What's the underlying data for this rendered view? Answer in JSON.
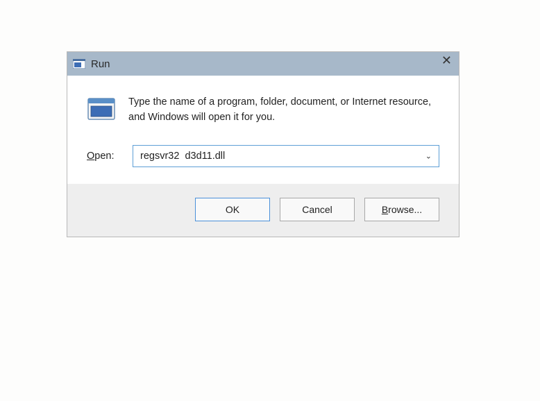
{
  "dialog": {
    "title": "Run",
    "description": "Type the name of a program, folder, document, or Internet resource, and Windows will open it for you.",
    "open_label_prefix": "O",
    "open_label_rest": "pen:",
    "command_value": "regsvr32  d3d11.dll",
    "buttons": {
      "ok": "OK",
      "cancel": "Cancel",
      "browse_prefix": "B",
      "browse_rest": "rowse..."
    }
  }
}
